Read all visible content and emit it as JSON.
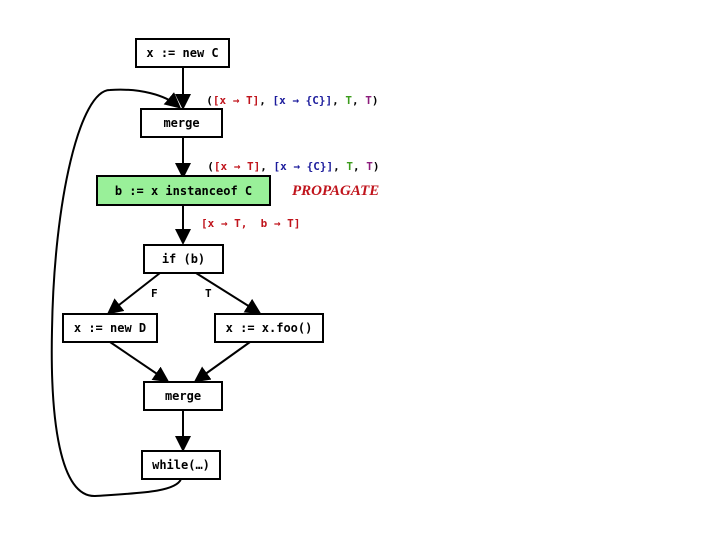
{
  "nodes": {
    "new_c": "x := new C",
    "merge1": "merge",
    "instanceof": "b := x instanceof C",
    "if_b": "if (b)",
    "new_d": "x := new D",
    "foo": "x := x.foo()",
    "merge2": "merge",
    "while": "while(…)"
  },
  "edge_labels": {
    "after_new_c": {
      "open": "(",
      "a": "[x → T]",
      "sep1": ", ",
      "b": "[x → {C}]",
      "sep2": ", ",
      "c": "T",
      "sep3": ", ",
      "d": "T",
      "close": ")"
    },
    "after_merge": {
      "open": "(",
      "a": "[x → T]",
      "sep1": ", ",
      "b": "[x → {C}]",
      "sep2": ", ",
      "c": "T",
      "sep3": ", ",
      "d": "T",
      "close": ")"
    },
    "after_instanceof": "[x → T,  b → T]",
    "branch_false": "F",
    "branch_true": "T"
  },
  "annotation": "PROPAGATE",
  "colors": {
    "highlight": "#99f099",
    "red": "#c0141c",
    "blue": "#1c1c9c",
    "green": "#3c9c1c",
    "purple": "#8c1c7c"
  }
}
